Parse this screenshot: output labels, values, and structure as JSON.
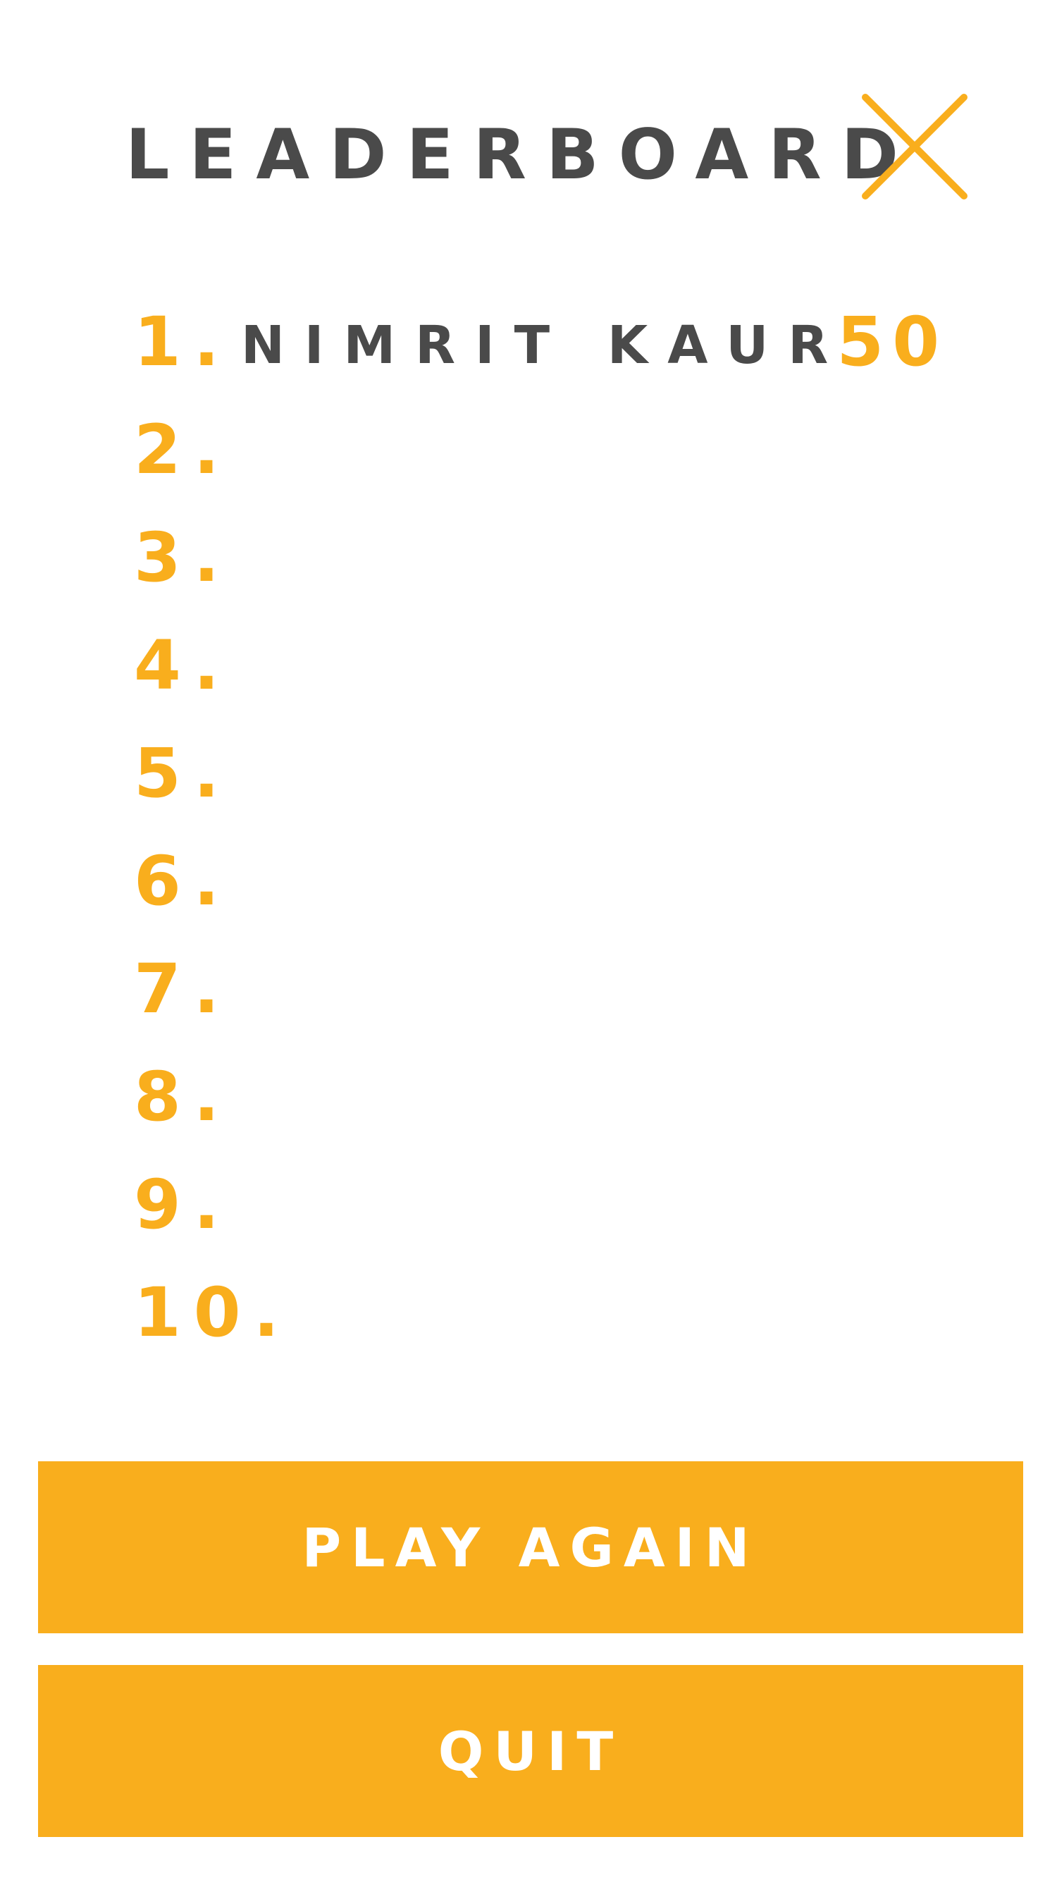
{
  "header": {
    "title": "LEADERBOARD",
    "close_icon": "close-x-icon"
  },
  "leaderboard": {
    "entries": [
      {
        "rank": "1.",
        "name": "NIMRIT KAUR",
        "score": "50"
      },
      {
        "rank": "2.",
        "name": "",
        "score": ""
      },
      {
        "rank": "3.",
        "name": "",
        "score": ""
      },
      {
        "rank": "4.",
        "name": "",
        "score": ""
      },
      {
        "rank": "5.",
        "name": "",
        "score": ""
      },
      {
        "rank": "6.",
        "name": "",
        "score": ""
      },
      {
        "rank": "7.",
        "name": "",
        "score": ""
      },
      {
        "rank": "8.",
        "name": "",
        "score": ""
      },
      {
        "rank": "9.",
        "name": "",
        "score": ""
      },
      {
        "rank": "10.",
        "name": "",
        "score": ""
      }
    ]
  },
  "actions": {
    "play_again_label": "PLAY AGAIN",
    "quit_label": "QUIT"
  },
  "colors": {
    "accent": "#F9AE1D",
    "text_dark": "#4A4A4A",
    "background": "#FFFFFF",
    "button_text": "#FFFFFF"
  }
}
